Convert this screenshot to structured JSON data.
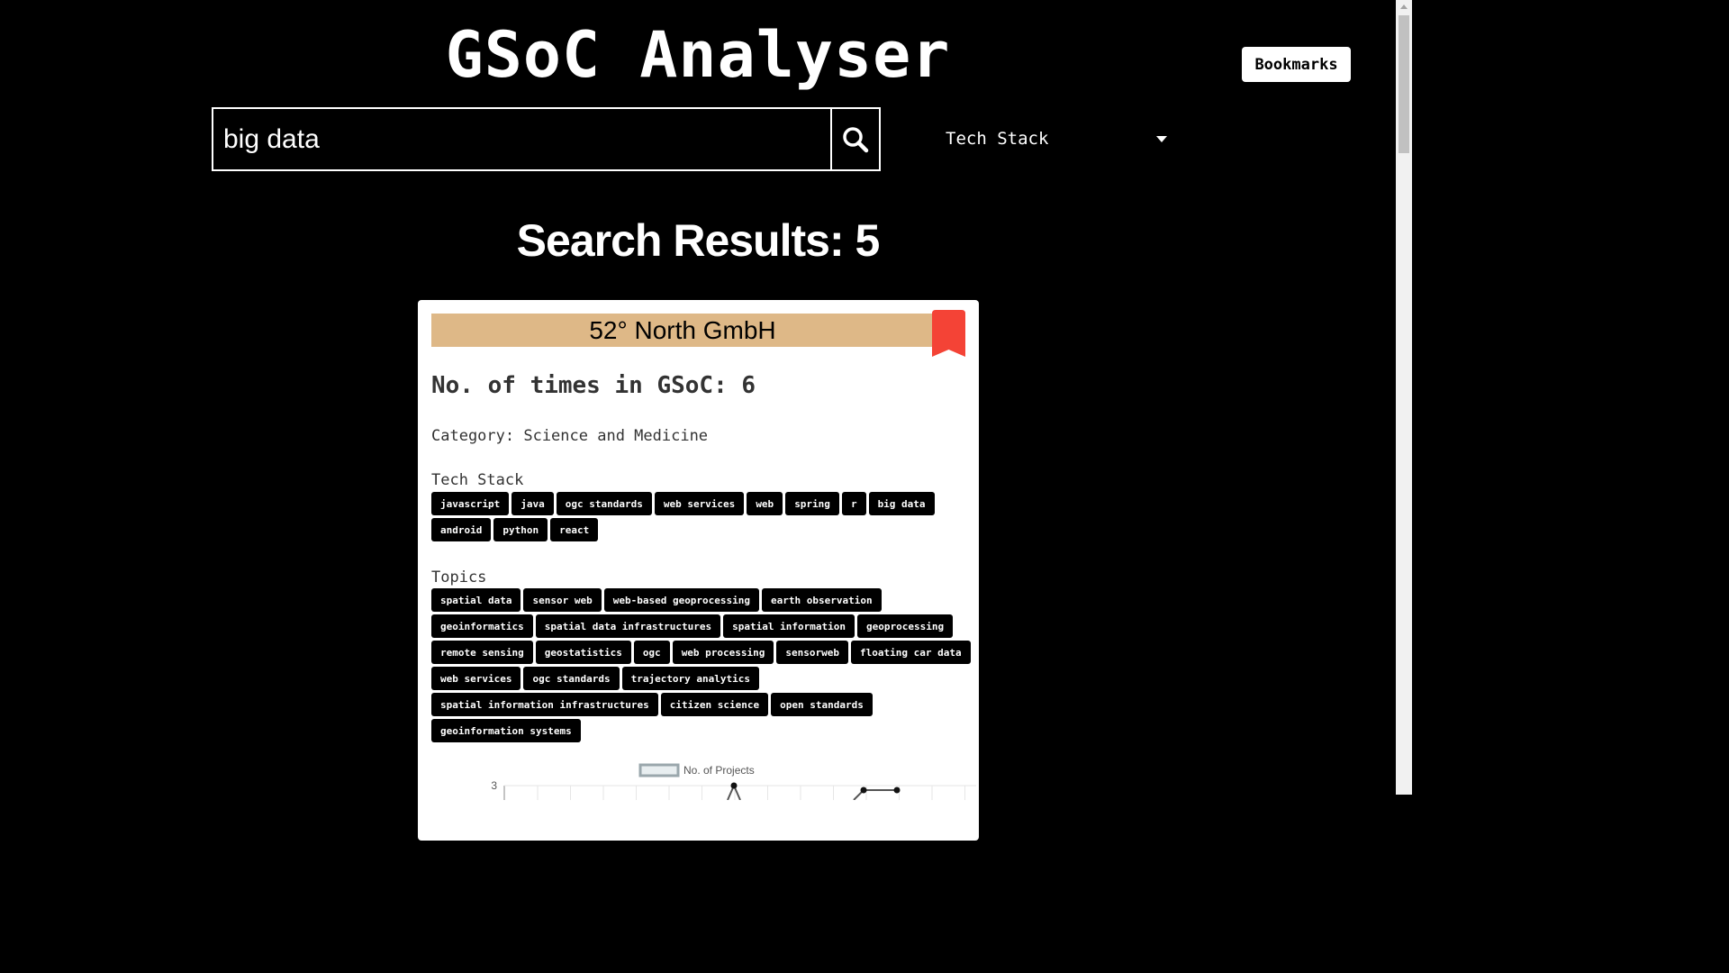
{
  "header": {
    "title": "GSoC Analyser",
    "bookmarks_label": "Bookmarks"
  },
  "search": {
    "value": "big data",
    "icon": "search-icon"
  },
  "filter": {
    "selected": "Tech Stack"
  },
  "results": {
    "heading": "Search Results: 5"
  },
  "card": {
    "org_name": "52° North GmbH",
    "banner_color": "#deb887",
    "bookmark_color": "#f44336",
    "gsoc_count": "No. of times in GSoC: 6",
    "category": "Category: Science and Medicine",
    "tech_stack_label": "Tech Stack",
    "tech_stack": [
      "javascript",
      "java",
      "ogc standards",
      "web services",
      "web",
      "spring",
      "r",
      "big data",
      "android",
      "python",
      "react"
    ],
    "topics_label": "Topics",
    "topics": [
      "spatial data",
      "sensor web",
      "web-based geoprocessing",
      "earth observation",
      "geoinformatics",
      "spatial data infrastructures",
      "spatial information",
      "geoprocessing",
      "remote sensing",
      "geostatistics",
      "ogc",
      "web processing",
      "sensorweb",
      "floating car data",
      "web services",
      "ogc standards",
      "trajectory analytics",
      "spatial information infrastructures",
      "citizen science",
      "open standards",
      "geoinformation systems"
    ]
  },
  "chart_data": {
    "type": "line",
    "series": [
      {
        "name": "No. of Projects",
        "visible_y_label": "3"
      }
    ],
    "legend": "top"
  }
}
